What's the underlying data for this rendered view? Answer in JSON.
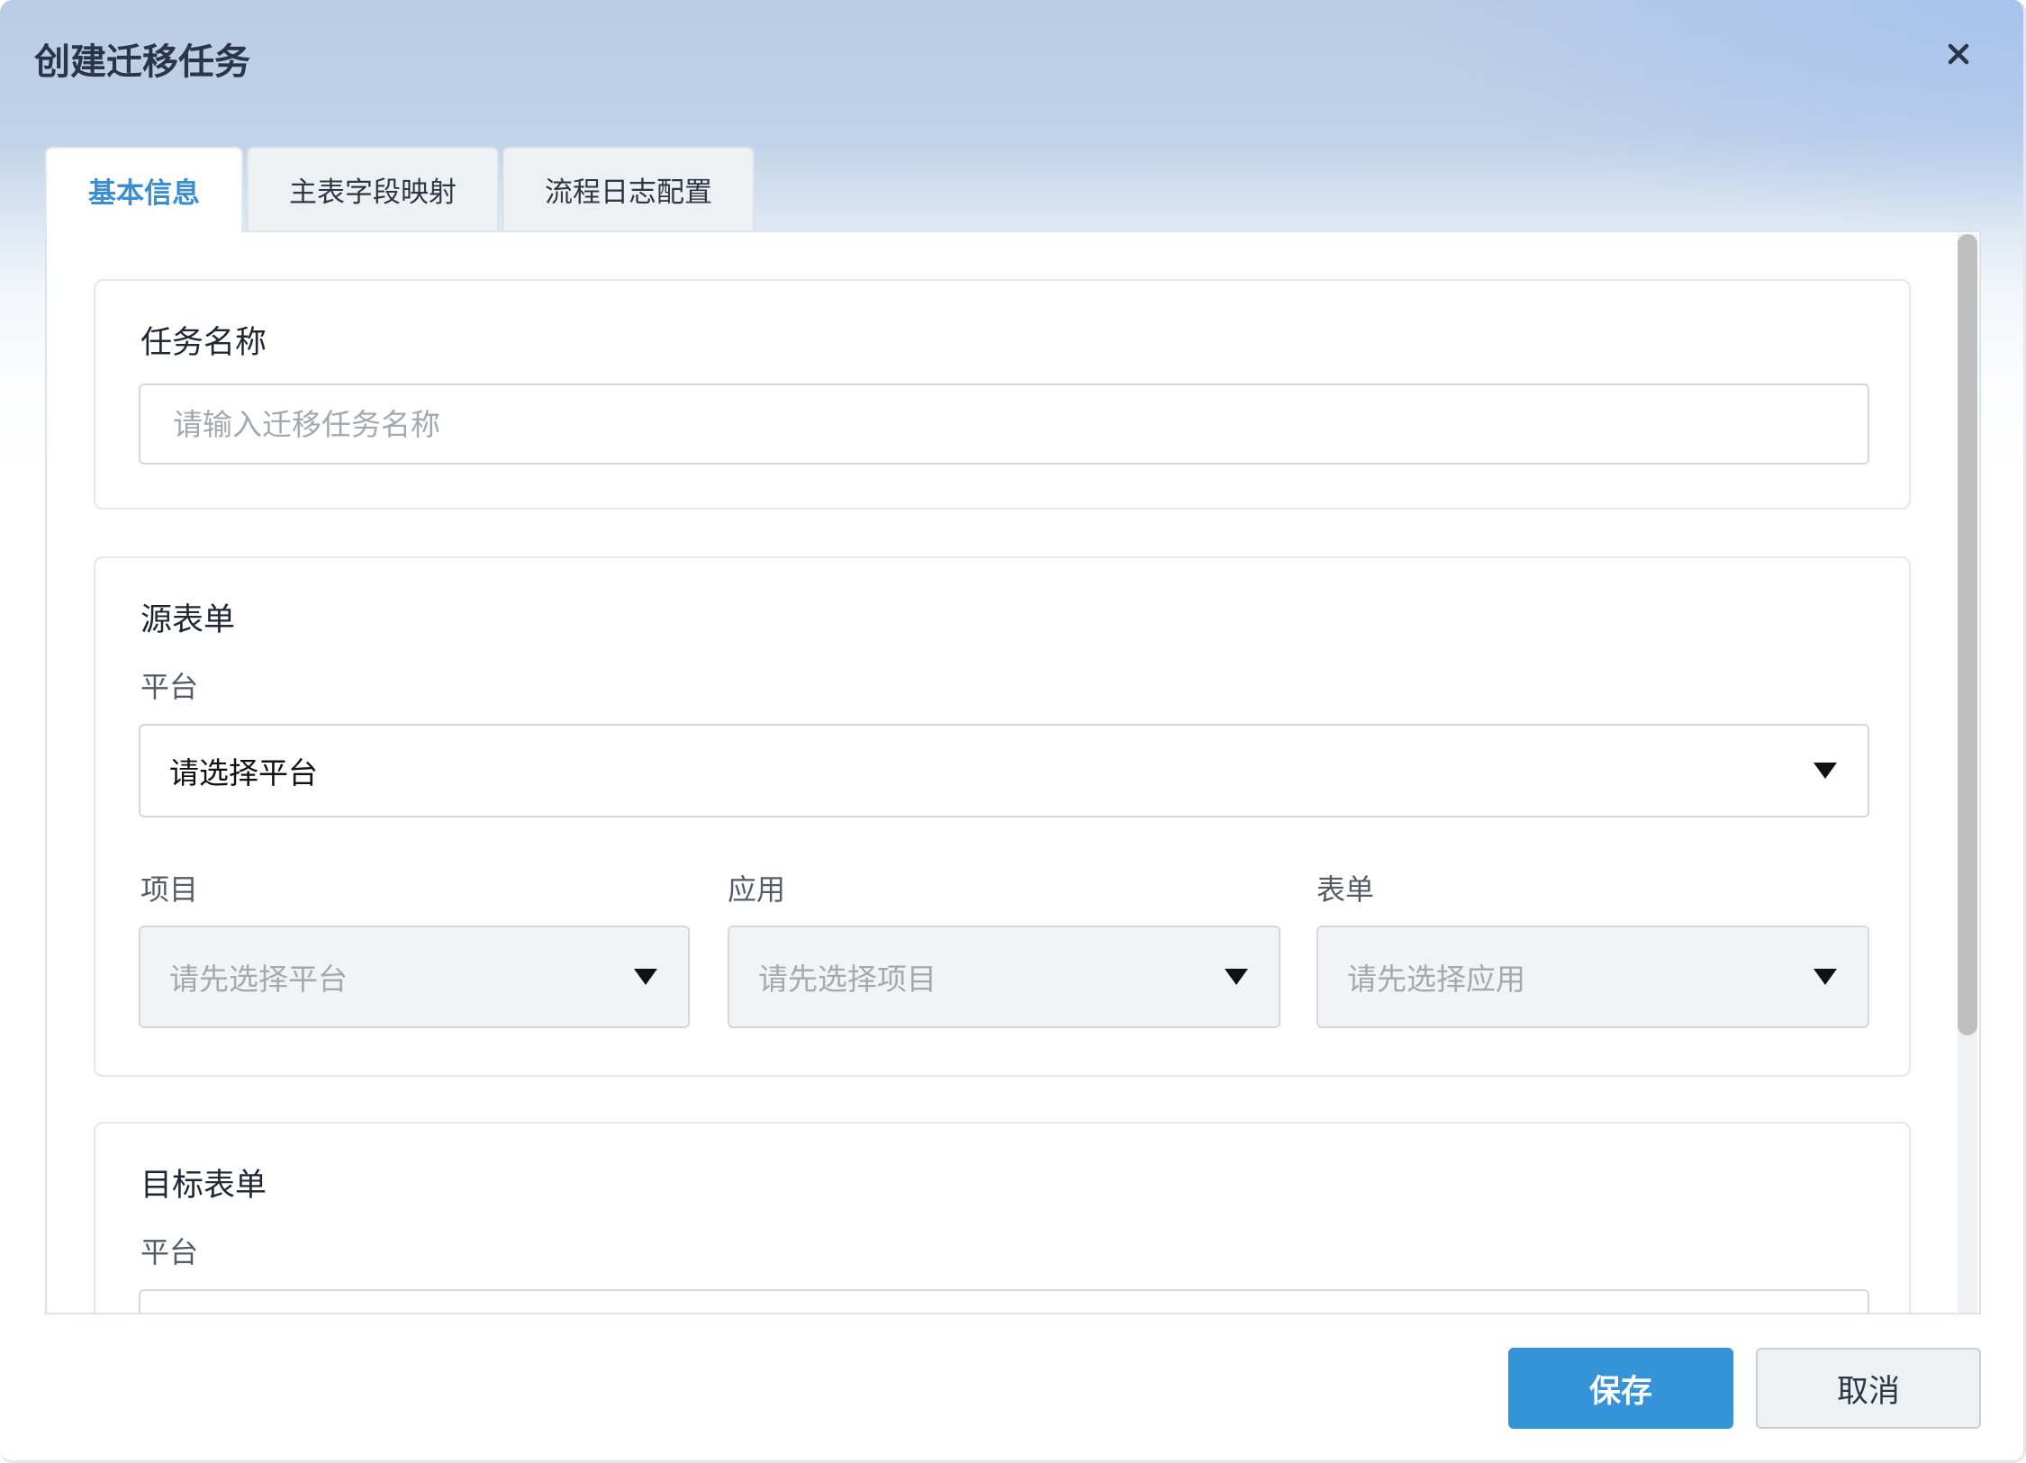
{
  "dialog": {
    "title": "创建迁移任务"
  },
  "tabs": [
    {
      "label": "基本信息",
      "active": true
    },
    {
      "label": "主表字段映射",
      "active": false
    },
    {
      "label": "流程日志配置",
      "active": false
    }
  ],
  "task_name": {
    "title": "任务名称",
    "placeholder": "请输入迁移任务名称",
    "value": ""
  },
  "source_form": {
    "title": "源表单",
    "platform_label": "平台",
    "platform_value": "请选择平台",
    "project_label": "项目",
    "project_value": "请先选择平台",
    "app_label": "应用",
    "app_value": "请先选择项目",
    "form_label": "表单",
    "form_value": "请先选择应用"
  },
  "target_form": {
    "title": "目标表单",
    "platform_label": "平台"
  },
  "footer": {
    "save_label": "保存",
    "cancel_label": "取消"
  },
  "colors": {
    "accent": "#3593da",
    "active_tab_text": "#3a8fd3",
    "title_text": "#2a3648"
  }
}
